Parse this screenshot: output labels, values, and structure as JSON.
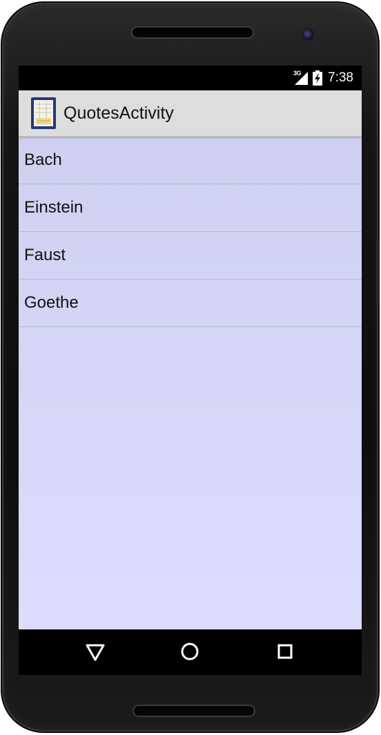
{
  "status_bar": {
    "network": "3G",
    "time": "7:38"
  },
  "action_bar": {
    "title": "QuotesActivity",
    "icon": "app-icon"
  },
  "list": {
    "items": [
      "Bach",
      "Einstein",
      "Faust",
      "Goethe"
    ]
  },
  "nav_bar": {
    "buttons": [
      "back-icon",
      "home-icon",
      "recents-icon"
    ]
  },
  "colors": {
    "action_bar_bg": "#dddddd",
    "list_bg": "#d3d4f4",
    "status_bar_bg": "#000000"
  }
}
